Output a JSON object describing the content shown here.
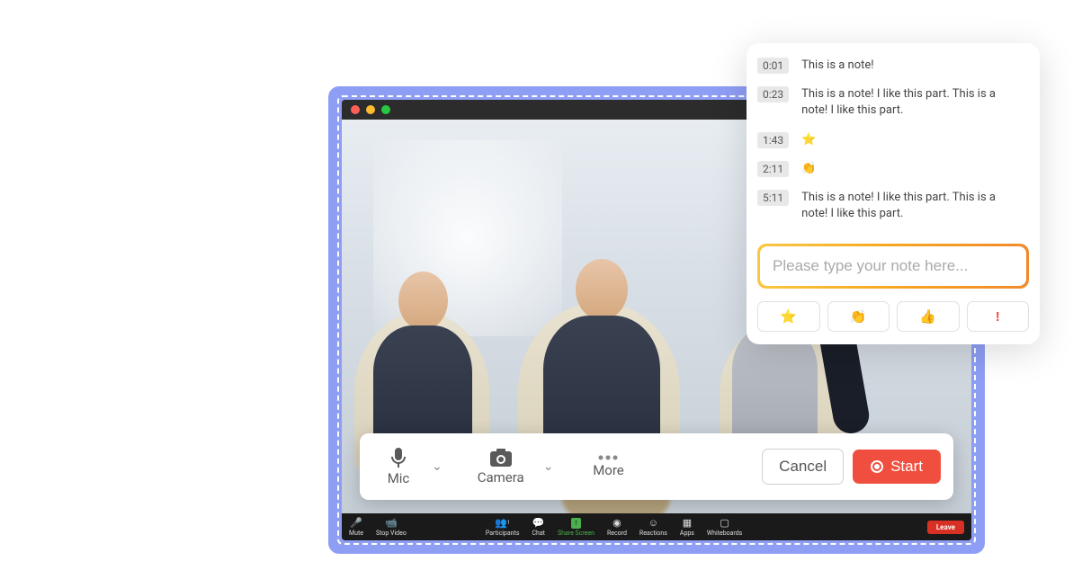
{
  "recording_controls": {
    "mic_label": "Mic",
    "camera_label": "Camera",
    "more_label": "More",
    "cancel_label": "Cancel",
    "start_label": "Start"
  },
  "zoom_bar": {
    "mute": "Mute",
    "stop_video": "Stop Video",
    "participants": "Participants",
    "participants_count": "1",
    "chat": "Chat",
    "share_screen": "Share Screen",
    "record": "Record",
    "reactions": "Reactions",
    "apps": "Apps",
    "whiteboards": "Whiteboards",
    "leave": "Leave"
  },
  "notes": {
    "items": [
      {
        "time": "0:01",
        "content": "This is a note!"
      },
      {
        "time": "0:23",
        "content": "This is a note! I like this part. This is a note! I like this part."
      },
      {
        "time": "1:43",
        "content": "⭐"
      },
      {
        "time": "2:11",
        "content": "👏"
      },
      {
        "time": "5:11",
        "content": "This is a note! I like this part. This is a note! I like this part."
      }
    ],
    "input_placeholder": "Please type your note here...",
    "reactions": [
      "⭐",
      "👏",
      "👍",
      "!"
    ]
  }
}
